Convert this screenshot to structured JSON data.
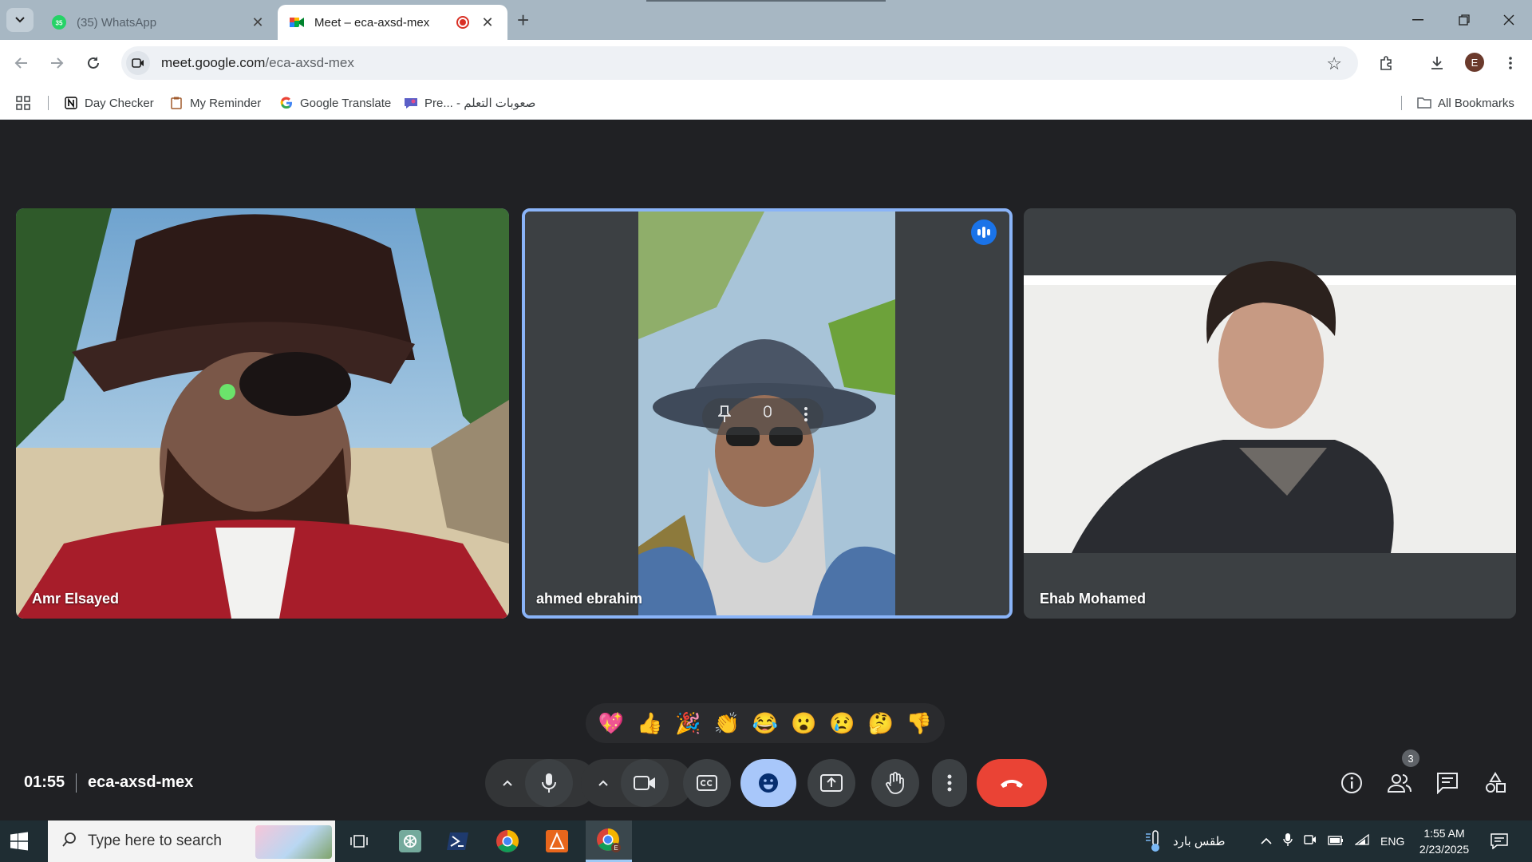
{
  "browser": {
    "tabs": [
      {
        "title": "(35) WhatsApp",
        "badge": "35",
        "active": false
      },
      {
        "title": "Meet – eca-axsd-mex",
        "active": true
      }
    ],
    "url_host": "meet.google.com",
    "url_path": "/eca-axsd-mex",
    "profile_initial": "E",
    "bookmarks": [
      {
        "label": "Day Checker",
        "icon": "notion-icon"
      },
      {
        "label": "My Reminder",
        "icon": "clipboard-icon"
      },
      {
        "label": "Google Translate",
        "icon": "google-icon"
      },
      {
        "label": "Pre... - صعوبات التعلم",
        "icon": "bookmark-app-icon"
      }
    ],
    "all_bookmarks": "All Bookmarks"
  },
  "meeting": {
    "time": "01:55",
    "code": "eca-axsd-mex",
    "participants": [
      {
        "name": "Amr Elsayed"
      },
      {
        "name": "ahmed ebrahim",
        "speaking": true,
        "pinned": true
      },
      {
        "name": "Ehab Mohamed"
      }
    ],
    "participant_count": "3",
    "reactions": [
      "💖",
      "👍",
      "🎉",
      "👏",
      "😂",
      "😮",
      "😢",
      "🤔",
      "👎"
    ]
  },
  "taskbar": {
    "search_placeholder": "Type here to search",
    "weather": "طقس بارد",
    "language": "ENG",
    "time": "1:55 AM",
    "date": "2/23/2025"
  },
  "colors": {
    "meet_bg": "#202124",
    "tile_bg": "#3c4043",
    "speaking_border": "#8ab4f8",
    "end_call": "#ea4335",
    "reactions_active": "#a8c7fa",
    "tabstrip": "#a7b7c3",
    "taskbar": "#1f2d33"
  }
}
